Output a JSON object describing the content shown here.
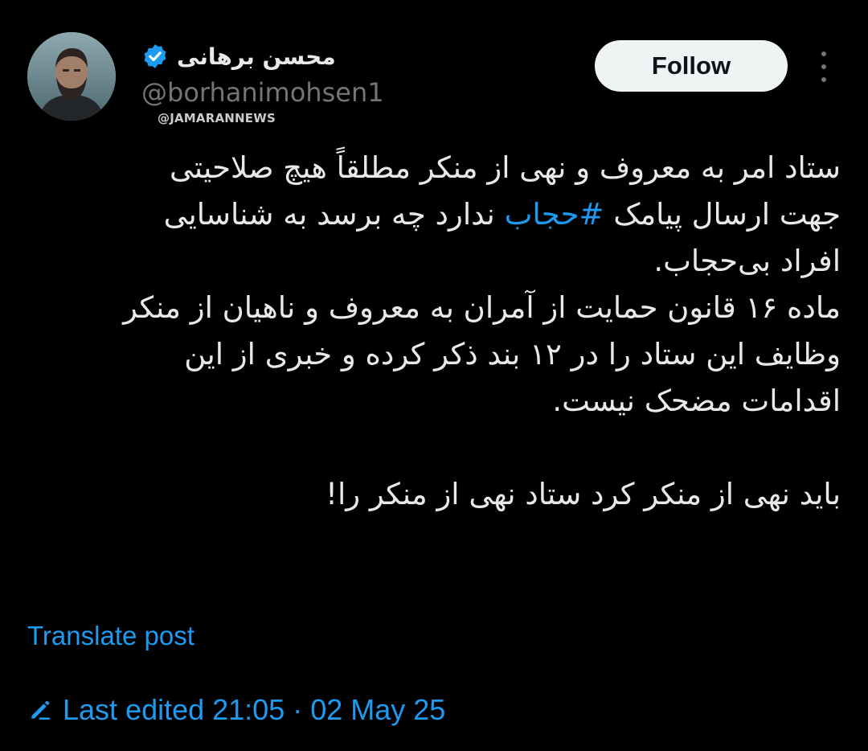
{
  "author": {
    "display_name": "محسن برهانی",
    "handle": "@borhanimohsen1",
    "verified_icon": "verified-badge-icon",
    "avatar_icon": "avatar-photo"
  },
  "watermark": "@JAMARANNEWS",
  "actions": {
    "follow_label": "Follow",
    "more_icon": "more-options-icon"
  },
  "tweet": {
    "line1": "ستاد امر به معروف و نهی از منکر مطلقاً هیچ صلاحیتی",
    "line2_before": "جهت ارسال پیامک ",
    "line2_hashtag": "#حجاب",
    "line2_after": " ندارد چه برسد به شناسایی",
    "line3": "افراد بی‌حجاب.",
    "line4": "ماده ۱۶ قانون حمایت از آمران به معروف و ناهیان از منکر",
    "line5": "وظایف این ستاد را در ۱۲ بند ذکر کرده و خبری از این",
    "line6": "اقدامات مضحک نیست.",
    "line7": "باید نهی از منکر کرد ستاد نهی از منکر را!"
  },
  "translate_label": "Translate post",
  "edited": {
    "icon": "pencil-icon",
    "label": "Last edited 21:05 · 02 May 25"
  },
  "colors": {
    "background": "#000000",
    "text": "#e7e9ea",
    "secondary": "#71767b",
    "accent": "#1d9bf0",
    "button_bg": "#eff3f4"
  }
}
